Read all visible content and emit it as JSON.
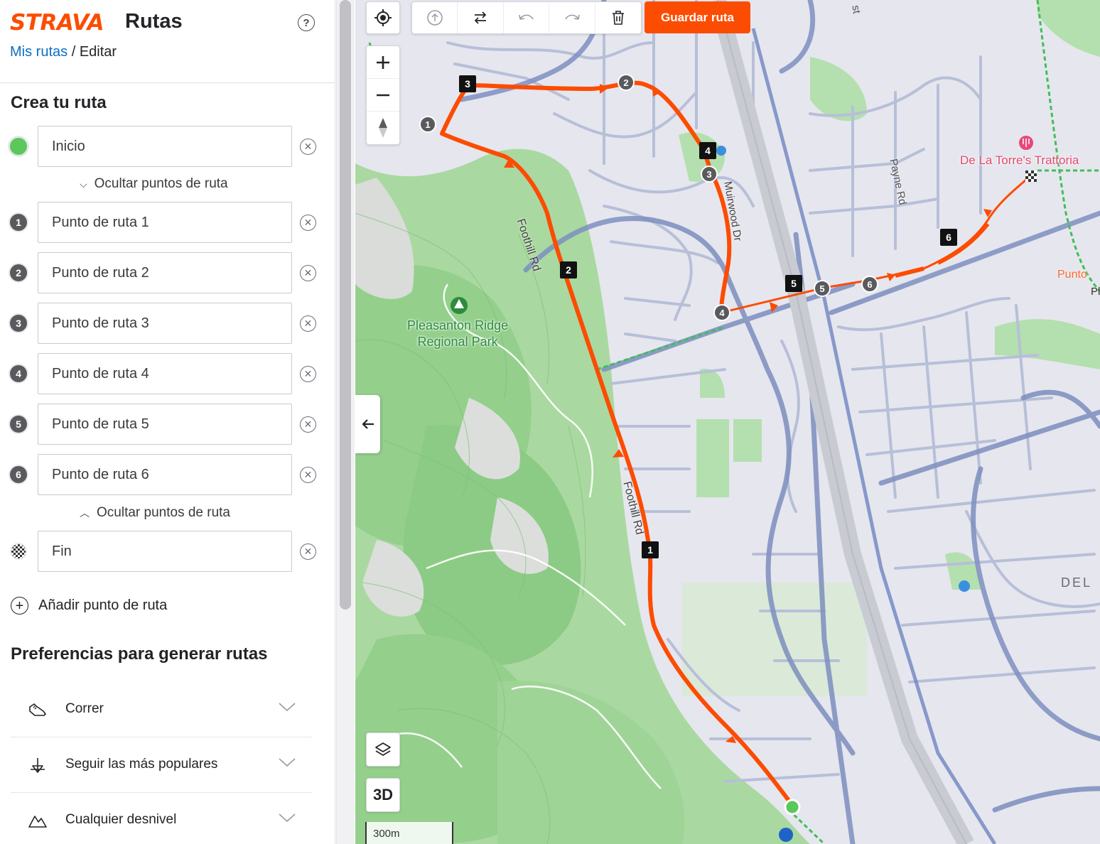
{
  "header": {
    "logo": "STRAVA",
    "app_title": "Rutas",
    "breadcrumb_link": "Mis rutas",
    "breadcrumb_sep": "/",
    "breadcrumb_current": "Editar",
    "help_icon": "?"
  },
  "builder": {
    "title": "Crea tu ruta",
    "start": "Inicio",
    "toggle_top": "Ocultar puntos de ruta",
    "toggle_bottom": "Ocultar puntos de ruta",
    "waypoints": [
      {
        "num": "1",
        "label": "Punto de ruta 1"
      },
      {
        "num": "2",
        "label": "Punto de ruta 2"
      },
      {
        "num": "3",
        "label": "Punto de ruta 3"
      },
      {
        "num": "4",
        "label": "Punto de ruta 4"
      },
      {
        "num": "5",
        "label": "Punto de ruta 5"
      },
      {
        "num": "6",
        "label": "Punto de ruta 6"
      }
    ],
    "end": "Fin",
    "add_waypoint": "Añadir punto de ruta"
  },
  "preferences": {
    "title": "Preferencias para generar rutas",
    "items": [
      {
        "label": "Correr",
        "icon": "shoe-icon"
      },
      {
        "label": "Seguir las más populares",
        "icon": "popularity-icon"
      },
      {
        "label": "Cualquier desnivel",
        "icon": "elevation-icon"
      }
    ]
  },
  "map": {
    "save_button": "Guardar ruta",
    "button_3d": "3D",
    "scale": "300m",
    "labels": {
      "park": "Pleasanton Ridge",
      "park2": "Regional Park",
      "restaurant": "De La Torre's Trattoria",
      "road_foothill_1": "Foothill Rd",
      "road_foothill_2": "Foothill Rd",
      "road_muirwood": "Muirwood Dr",
      "road_payne": "Payne Rd",
      "area_del": "DEL",
      "poi_punto": "Punto",
      "st": "st",
      "pl": "Pl"
    },
    "route_markers": [
      "1",
      "2",
      "3",
      "4",
      "5",
      "6"
    ],
    "waypoint_markers": [
      "1",
      "2",
      "3",
      "4",
      "5",
      "6"
    ],
    "colors": {
      "route": "#fc4c02",
      "accent": "#fc4c02",
      "park": "#a8d8a0",
      "start": "#5ac85a"
    }
  }
}
